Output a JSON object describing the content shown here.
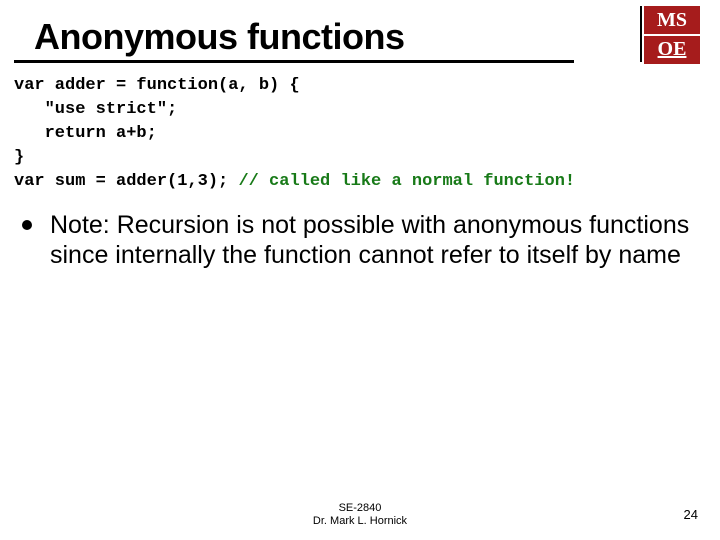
{
  "title": "Anonymous functions",
  "logo": {
    "top": "MS",
    "bottom": "OE"
  },
  "code": {
    "l1": "var adder = function(a, b) {",
    "l2": "   \"use strict\";",
    "l3": "   return a+b;",
    "l4": "}",
    "l5a": "var sum = adder(1,3); ",
    "l5b": "// called like a normal function!"
  },
  "bullet": "Note: Recursion is not possible with anonymous functions since internally the function cannot refer to itself by name",
  "footer": {
    "course": "SE-2840",
    "author": "Dr. Mark L. Hornick"
  },
  "page": "24"
}
